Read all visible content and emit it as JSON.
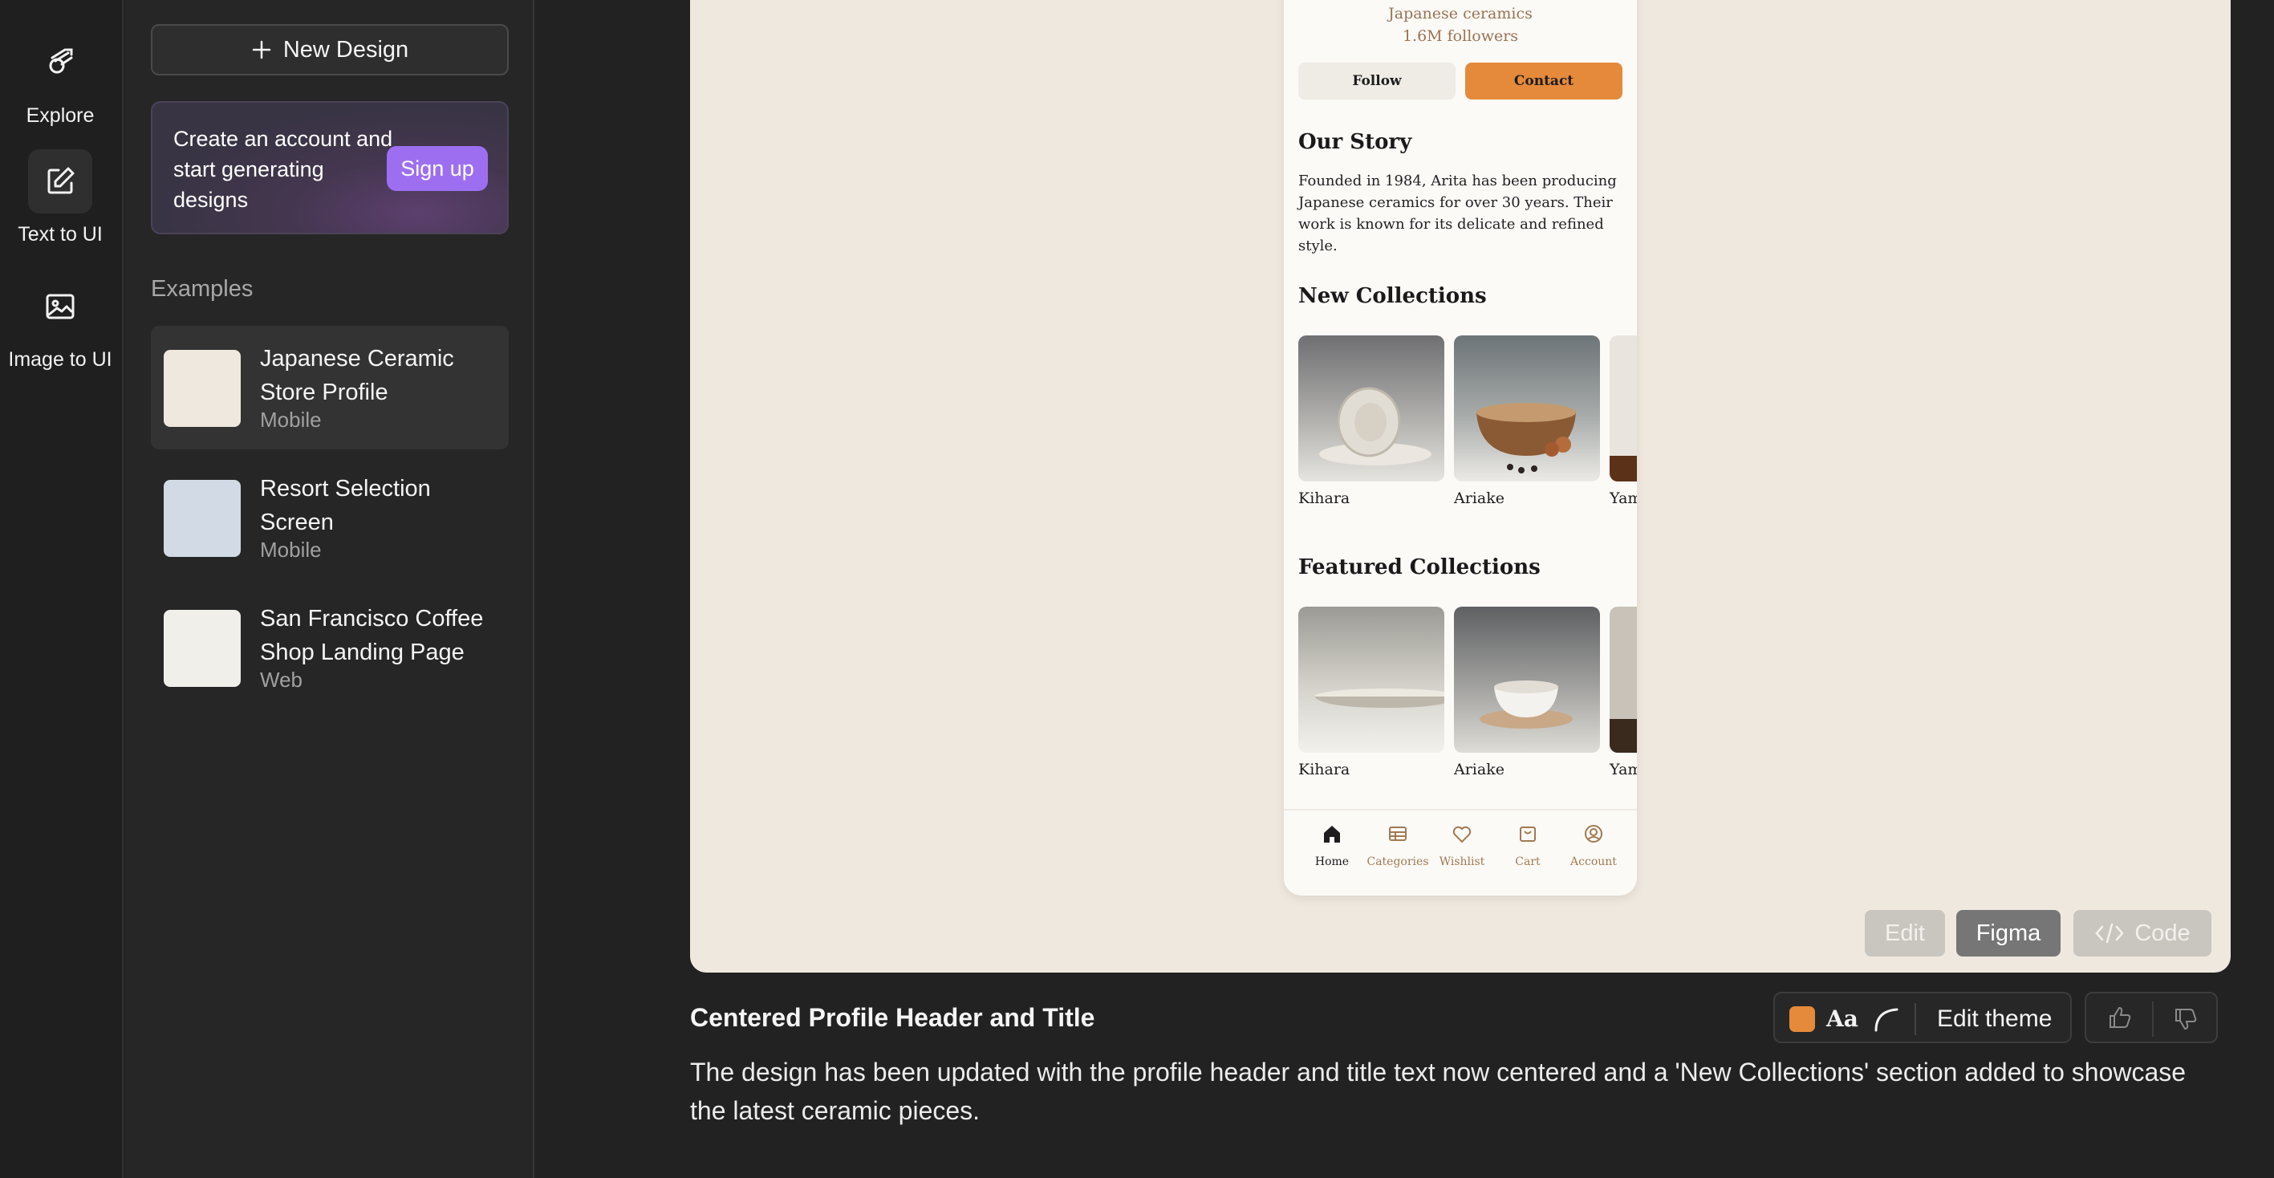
{
  "sidebar": {
    "items": [
      {
        "label": "Explore",
        "icon": "explore-icon",
        "active": false
      },
      {
        "label": "Text to UI",
        "icon": "edit-icon",
        "active": true
      },
      {
        "label": "Image to UI",
        "icon": "image-icon",
        "active": false
      }
    ]
  },
  "panel": {
    "new_design_label": "New Design",
    "promo_text": "Create an account and start generating designs",
    "signup_label": "Sign up",
    "examples_title": "Examples",
    "examples": [
      {
        "title": "Japanese Ceramic Store Profile",
        "type": "Mobile",
        "thumb_color": "#efe8de",
        "active": true
      },
      {
        "title": "Resort Selection Screen",
        "type": "Mobile",
        "thumb_color": "#d1dae5",
        "active": false
      },
      {
        "title": "San Francisco Coffee Shop Landing Page",
        "type": "Web",
        "thumb_color": "#f0efea",
        "active": false
      }
    ]
  },
  "preview": {
    "subtitle": "Japanese ceramics",
    "followers": "1.6M followers",
    "follow_label": "Follow",
    "contact_label": "Contact",
    "story_title": "Our Story",
    "story_text": "Founded in 1984, Arita has been producing Japanese ceramics for over 30 years. Their work is known for its delicate and refined style.",
    "new_collections_title": "New Collections",
    "new_collections": [
      "Kihara",
      "Ariake",
      "Yam"
    ],
    "featured_collections_title": "Featured Collections",
    "featured_collections": [
      "Kihara",
      "Ariake",
      "Yam"
    ],
    "nav": [
      "Home",
      "Categories",
      "Wishlist",
      "Cart",
      "Account"
    ],
    "accent_color": "#e58a3a"
  },
  "canvas_actions": {
    "edit_label": "Edit",
    "figma_label": "Figma",
    "code_label": "Code"
  },
  "message": {
    "title": "Centered Profile Header and Title",
    "body": "The design has been updated with the profile header and title text now centered and a 'New Collections' section added to showcase the latest ceramic pieces.",
    "theme_swatch_color": "#e58a3a",
    "font_label": "Aa",
    "edit_theme_label": "Edit theme"
  }
}
